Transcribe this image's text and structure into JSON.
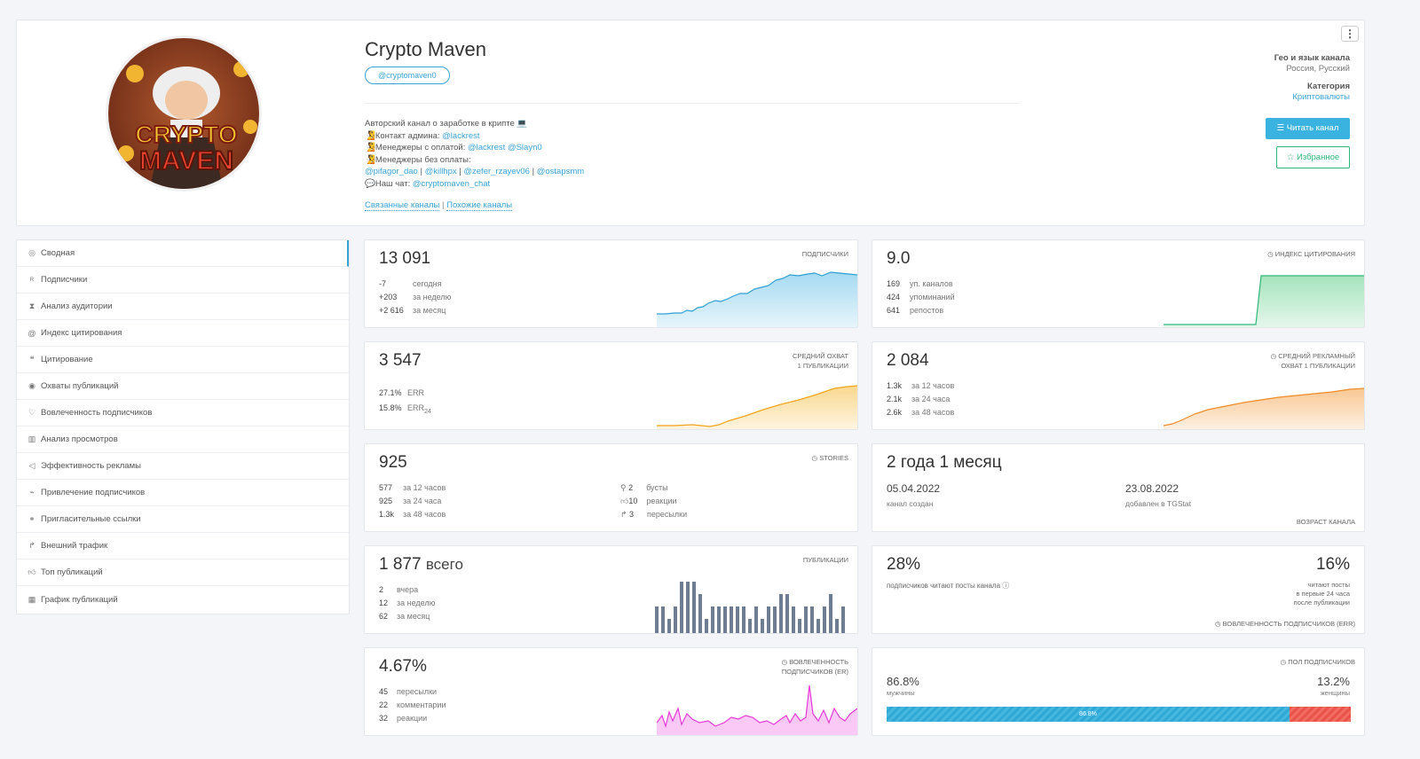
{
  "header": {
    "title": "Crypto Maven",
    "handle": "@cryptomaven0",
    "description": {
      "line1": "Авторский канал о заработке в крипте 💻",
      "contact_label": "🧏Контакт админа: ",
      "contact_link": "@lackrest",
      "paid_label": "🧏Менеджеры с оплатой: ",
      "paid_link1": "@lackrest",
      "paid_link2": "@Slayn0",
      "free_label": "🧏Менеджеры без оплаты:",
      "free_links": [
        "@pifagor_dao",
        "@killhpx",
        "@zefer_rzayev06",
        "@ostapsmm"
      ],
      "chat_label": "💬Наш чат: ",
      "chat_link": "@cryptomaven_chat"
    },
    "related_link": "Связанные каналы",
    "similar_link": "Похожие каналы",
    "geo_label": "Гео и язык канала",
    "geo_value": "Россия, Русский",
    "category_label": "Категория",
    "category_value": "Криптовалюты",
    "read_button": "Читать канал",
    "fav_button": "Избранное",
    "avatar_text": [
      "CRYPTO",
      "MAVEN"
    ]
  },
  "sidebar": {
    "items": [
      {
        "label": "Сводная",
        "icon": "dashboard-icon"
      },
      {
        "label": "Подписчики",
        "icon": "users-icon"
      },
      {
        "label": "Анализ аудитории",
        "icon": "hourglass-icon"
      },
      {
        "label": "Индекс цитирования",
        "icon": "at-icon"
      },
      {
        "label": "Цитирование",
        "icon": "quote-icon"
      },
      {
        "label": "Охваты публикаций",
        "icon": "eye-icon"
      },
      {
        "label": "Вовлеченность подписчиков",
        "icon": "heart-icon"
      },
      {
        "label": "Анализ просмотров",
        "icon": "bar-chart-icon"
      },
      {
        "label": "Эффективность рекламы",
        "icon": "megaphone-icon"
      },
      {
        "label": "Привлечение подписчиков",
        "icon": "trend-icon"
      },
      {
        "label": "Пригласительные ссылки",
        "icon": "link-icon"
      },
      {
        "label": "Внешний трафик",
        "icon": "external-icon"
      },
      {
        "label": "Топ публикаций",
        "icon": "thumbs-up-icon"
      },
      {
        "label": "График публикаций",
        "icon": "calendar-icon"
      }
    ]
  },
  "subs": {
    "value": "13 091",
    "label": "ПОДПИСЧИКИ",
    "rows": [
      [
        "-7",
        "сегодня"
      ],
      [
        "+203",
        "за неделю"
      ],
      [
        "+2 616",
        "за месяц"
      ]
    ]
  },
  "citation": {
    "value": "9.0",
    "label": "ИНДЕКС ЦИТИРОВАНИЯ",
    "rows": [
      [
        "169",
        "уп. каналов"
      ],
      [
        "424",
        "упоминаний"
      ],
      [
        "641",
        "репостов"
      ]
    ]
  },
  "reach": {
    "value": "3 547",
    "label1": "СРЕДНИЙ ОХВАТ",
    "label2": "1 ПУБЛИКАЦИИ",
    "rows": [
      [
        "27.1%",
        "ERR"
      ],
      [
        "15.8%",
        "ERR",
        "24"
      ]
    ]
  },
  "ad_reach": {
    "value": "2 084",
    "label1": "СРЕДНИЙ РЕКЛАМНЫЙ",
    "label2": "ОХВАТ 1 ПУБЛИКАЦИИ",
    "rows": [
      [
        "1.3k",
        "за 12 часов"
      ],
      [
        "2.1k",
        "за 24 часа"
      ],
      [
        "2.6k",
        "за 48 часов"
      ]
    ]
  },
  "stories": {
    "value": "925",
    "label": "STORIES",
    "rows": [
      [
        "577",
        "за 12 часов"
      ],
      [
        "925",
        "за 24 часа"
      ],
      [
        "1.3k",
        "за 48 часов"
      ]
    ],
    "rows2": [
      [
        "2",
        "бусты"
      ],
      [
        "10",
        "реакции"
      ],
      [
        "3",
        "пересылки"
      ]
    ]
  },
  "age": {
    "value": "2 года 1 месяц",
    "created_date": "05.04.2022",
    "created_label": "канал создан",
    "added_date": "23.08.2022",
    "added_label": "добавлен в TGStat",
    "label": "ВОЗРАСТ КАНАЛА"
  },
  "posts": {
    "value": "1 877",
    "suffix": "всего",
    "label": "ПУБЛИКАЦИИ",
    "rows": [
      [
        "2",
        "вчера"
      ],
      [
        "12",
        "за неделю"
      ],
      [
        "62",
        "за месяц"
      ]
    ]
  },
  "engagement": {
    "left_value": "28%",
    "left_text": "подписчиков читают посты канала ⓘ",
    "right_value": "16%",
    "right_text1": "читают посты",
    "right_text2": "в первые 24 часа",
    "right_text3": "после публикации",
    "label": "ВОВЛЕЧЕННОСТЬ ПОДПИСЧИКОВ (ERR)"
  },
  "er": {
    "value": "4.67%",
    "label1": "ВОВЛЕЧЕННОСТЬ",
    "label2": "ПОДПИСЧИКОВ (ER)",
    "rows": [
      [
        "45",
        "пересылки"
      ],
      [
        "22",
        "комментарии"
      ],
      [
        "32",
        "реакции"
      ]
    ]
  },
  "gender": {
    "label": "ПОЛ ПОДПИСЧИКОВ",
    "male_value": "86.8%",
    "male_label": "мужчины",
    "female_value": "13.2%",
    "female_label": "женщины",
    "bar_text": "86.8%",
    "male_fraction": 0.868
  },
  "colors": {
    "accent": "#3aa3d6",
    "green": "#2fb67a",
    "red": "#e0533f",
    "orange": "#f5a623"
  }
}
